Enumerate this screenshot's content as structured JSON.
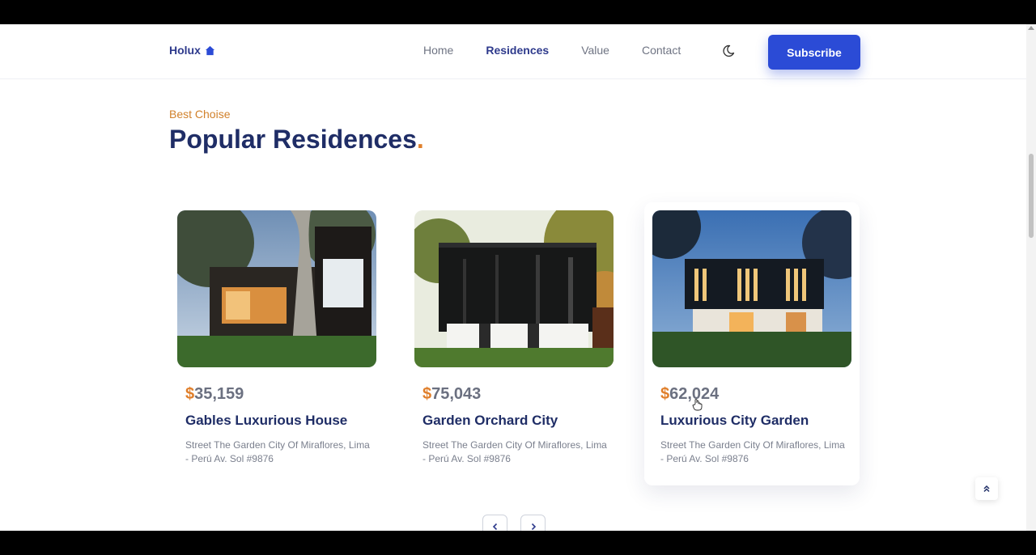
{
  "brand": {
    "name": "Holux",
    "icon": "home-icon",
    "accent": "#2b4bd6",
    "highlight": "#e07f2b",
    "heading_color": "#1f2d66"
  },
  "nav": {
    "items": [
      {
        "label": "Home",
        "active": false
      },
      {
        "label": "Residences",
        "active": true
      },
      {
        "label": "Value",
        "active": false
      },
      {
        "label": "Contact",
        "active": false
      }
    ],
    "theme_icon": "moon-icon",
    "subscribe_label": "Subscribe"
  },
  "section": {
    "subtitle": "Best Choise",
    "title": "Popular Residences",
    "title_dot": "."
  },
  "cards": [
    {
      "currency": "$",
      "price": "35,159",
      "name": "Gables Luxurious House",
      "address": "Street The Garden City Of Miraflores, Lima - Perú Av. Sol #9876",
      "image": "house-photo-1"
    },
    {
      "currency": "$",
      "price": "75,043",
      "name": "Garden Orchard City",
      "address": "Street The Garden City Of Miraflores, Lima - Perú Av. Sol #9876",
      "image": "house-photo-2"
    },
    {
      "currency": "$",
      "price": "62,024",
      "name": "Luxurious City Garden",
      "address": "Street The Garden City Of Miraflores, Lima - Perú Av. Sol #9876",
      "image": "house-photo-3"
    }
  ],
  "pager": {
    "prev_icon": "chevron-left-icon",
    "next_icon": "chevron-right-icon"
  },
  "scroll_top_icon": "double-chevron-up-icon"
}
